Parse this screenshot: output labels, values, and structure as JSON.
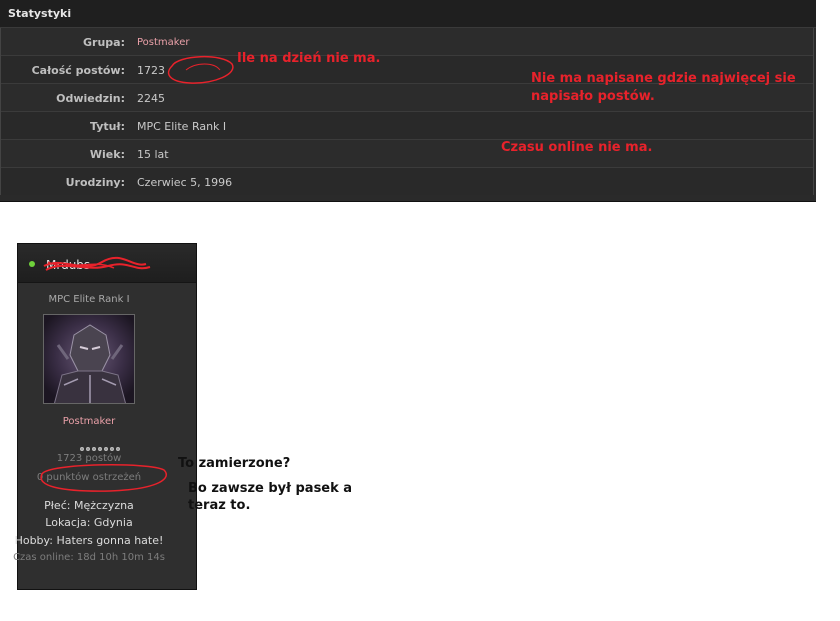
{
  "stats": {
    "title": "Statystyki",
    "rows": [
      {
        "label": "Grupa:",
        "value": "Postmaker"
      },
      {
        "label": "Całość postów:",
        "value": "1723"
      },
      {
        "label": "Odwiedzin:",
        "value": "2245"
      },
      {
        "label": "Tytuł:",
        "value": "MPC Elite Rank I"
      },
      {
        "label": "Wiek:",
        "value": "15 lat"
      },
      {
        "label": "Urodziny:",
        "value": "Czerwiec 5, 1996"
      }
    ]
  },
  "profile": {
    "rank": "MPC Elite Rank I",
    "group": "Postmaker",
    "posts": "1723 postów",
    "warnings": "0 punktów ostrzeżeń",
    "gender": "Płeć: Mężczyzna",
    "location": "Lokacja: Gdynia",
    "hobby": "Hobby: Haters gonna hate!",
    "online_time": "Czas online: 18d 10h 10m 14s",
    "pips": 7
  },
  "annotations": {
    "per_day": "Ile na dzień nie ma.",
    "most_posts_line1": "Nie ma napisane gdzie najwięcej sie",
    "most_posts_line2": "napisało postów.",
    "online_time": "Czasu online nie ma.",
    "intended": "To zamierzone?",
    "bar_line1": "Bo zawsze był pasek a",
    "bar_line2": "teraz to."
  },
  "colors": {
    "accent_pink": "#e9a0a8",
    "annotation_red": "#e8222b",
    "online_green": "#6fd13b"
  }
}
